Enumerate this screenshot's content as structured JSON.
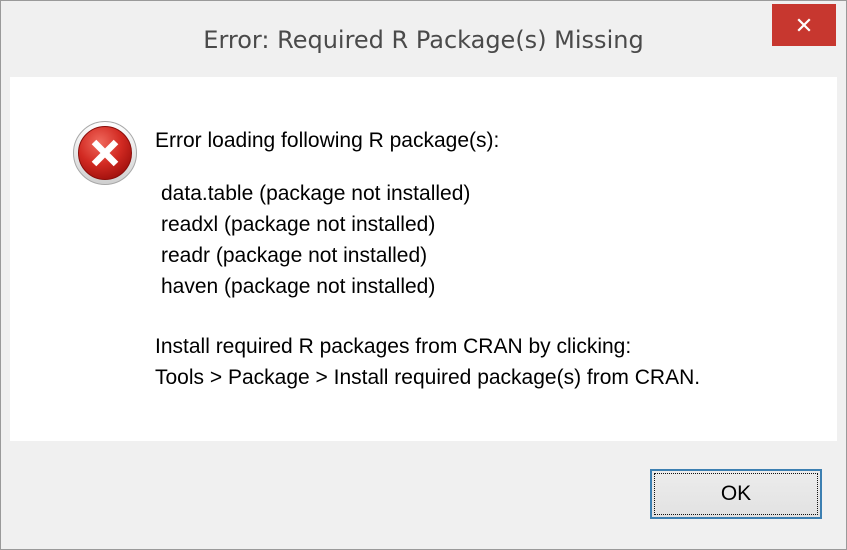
{
  "window": {
    "title": "Error: Required R Package(s) Missing",
    "close_icon": "close-icon"
  },
  "message": {
    "icon": "error-icon",
    "heading": "Error loading following R package(s):",
    "packages": [
      "data.table (package not installed)",
      "readxl (package not installed)",
      "readr (package not installed)",
      "haven (package not installed)"
    ],
    "instructions": [
      "Install required R packages from CRAN by clicking:",
      "Tools > Package > Install required package(s) from CRAN."
    ]
  },
  "buttons": {
    "ok_label": "OK"
  },
  "colors": {
    "close_button": "#c7372f",
    "error_icon": "#c8191c",
    "dialog_background": "#f0f0f0",
    "content_background": "#ffffff",
    "focus_border": "#3c7fb1"
  }
}
